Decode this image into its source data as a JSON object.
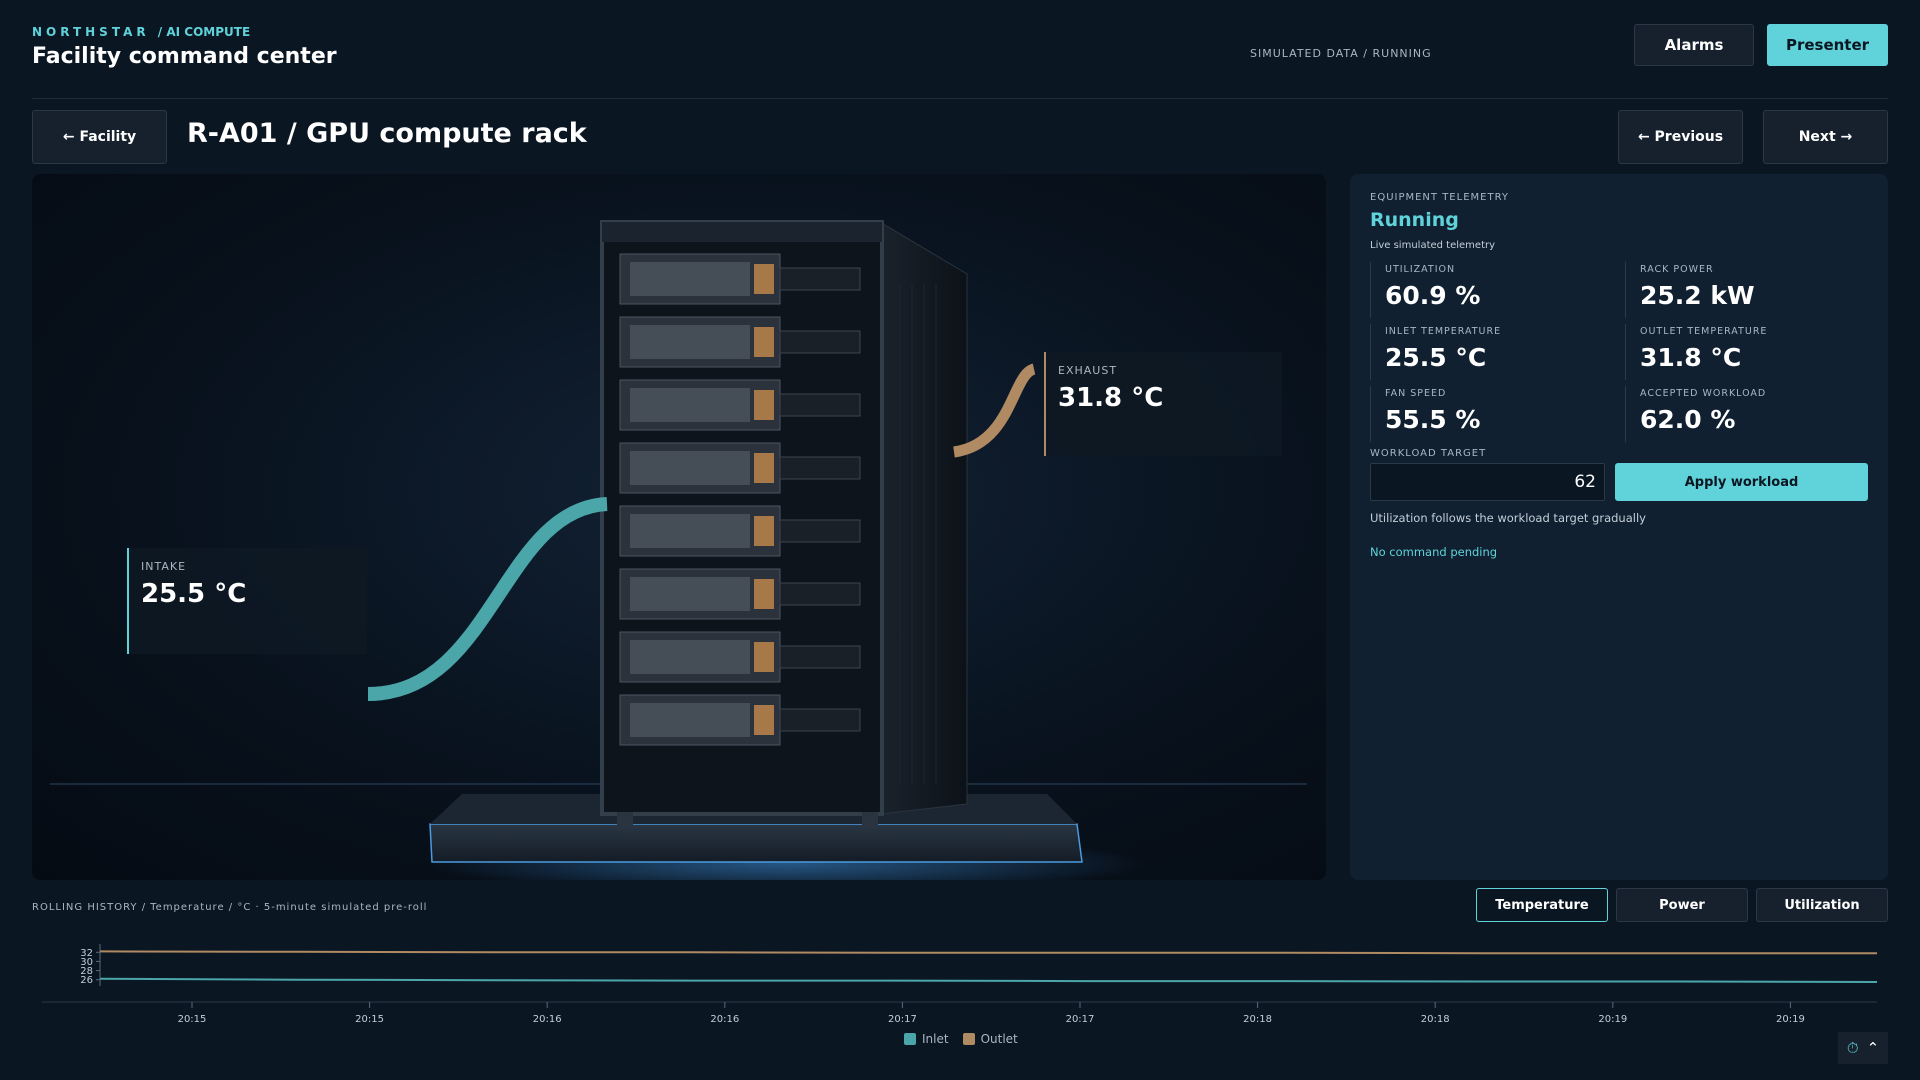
{
  "header": {
    "brand": "NORTHSTAR",
    "brand_suffix": "/ AI COMPUTE",
    "title": "Facility command center",
    "sim_status": "SIMULATED DATA / RUNNING",
    "alarms_label": "Alarms",
    "presenter_label": "Presenter"
  },
  "nav": {
    "back_label": "← Facility",
    "rack_title": "R-A01 / GPU compute rack",
    "previous_label": "← Previous",
    "next_label": "Next →"
  },
  "scene": {
    "intake_label": "INTAKE",
    "intake_value": "25.5 °C",
    "exhaust_label": "EXHAUST",
    "exhaust_value": "31.8 °C",
    "inlet_color": "#4aa6a8",
    "outlet_color": "#b08a63"
  },
  "telemetry": {
    "section": "EQUIPMENT TELEMETRY",
    "status": "Running",
    "subtitle": "Live simulated telemetry",
    "metrics": [
      {
        "label": "UTILIZATION",
        "value": "60.9 %"
      },
      {
        "label": "RACK POWER",
        "value": "25.2 kW"
      },
      {
        "label": "INLET TEMPERATURE",
        "value": "25.5 °C"
      },
      {
        "label": "OUTLET TEMPERATURE",
        "value": "31.8 °C"
      },
      {
        "label": "FAN SPEED",
        "value": "55.5 %"
      },
      {
        "label": "ACCEPTED WORKLOAD",
        "value": "62.0 %"
      }
    ],
    "workload_label": "WORKLOAD TARGET",
    "workload_value": "62",
    "apply_label": "Apply workload",
    "hint": "Utilization follows the workload target gradually",
    "command_status": "No command pending"
  },
  "history": {
    "label": "ROLLING HISTORY / Temperature / °C · 5-minute simulated pre-roll",
    "tabs": [
      {
        "label": "Temperature",
        "active": true
      },
      {
        "label": "Power",
        "active": false
      },
      {
        "label": "Utilization",
        "active": false
      }
    ]
  },
  "chart_data": {
    "type": "line",
    "x": [
      "20:15",
      "20:15",
      "20:16",
      "20:16",
      "20:17",
      "20:17",
      "20:18",
      "20:18",
      "20:19",
      "20:19"
    ],
    "y_ticks": [
      32,
      30,
      28,
      26
    ],
    "ylim": [
      25.5,
      32.5
    ],
    "series": [
      {
        "name": "Inlet",
        "color": "#4aa6a8",
        "values": [
          26.2,
          26.0,
          25.9,
          25.8,
          25.8,
          25.7,
          25.7,
          25.6,
          25.6,
          25.5
        ]
      },
      {
        "name": "Outlet",
        "color": "#b08a63",
        "values": [
          32.2,
          32.1,
          32.0,
          32.0,
          31.9,
          31.9,
          31.9,
          31.8,
          31.8,
          31.8
        ]
      }
    ]
  },
  "icons": {
    "timer": "timer-icon",
    "collapse": "chevron-up-icon"
  }
}
